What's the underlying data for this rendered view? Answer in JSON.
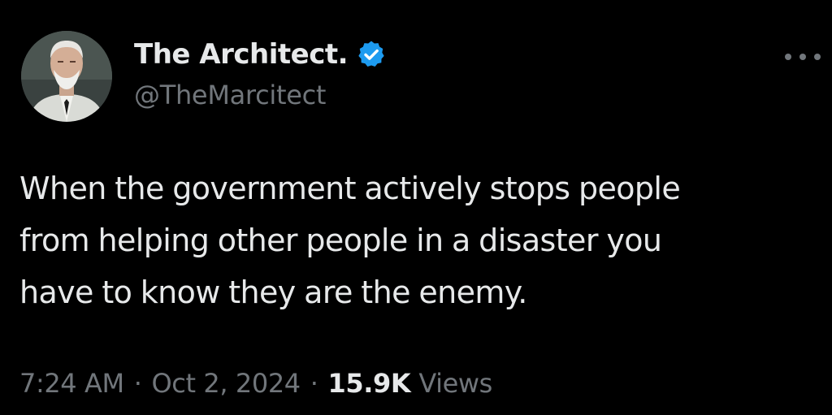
{
  "author": {
    "display_name": "The Architect.",
    "handle": "@TheMarcitect",
    "verified": true,
    "verified_badge_color": "#1d9bf0"
  },
  "tweet": {
    "text_lines": [
      "When the government actively stops people",
      "from helping other people in a disaster you",
      "have to know they are the enemy."
    ]
  },
  "meta": {
    "time": "7:24 AM",
    "separator": "·",
    "date": "Oct 2, 2024",
    "views_count": "15.9K",
    "views_label": "Views"
  },
  "colors": {
    "background": "#000000",
    "primary_text": "#e7e9ea",
    "secondary_text": "#71767b",
    "accent": "#1d9bf0"
  },
  "icons": {
    "avatar": "avatar-portrait",
    "verified": "verified-badge-icon",
    "more": "more-options-icon"
  }
}
